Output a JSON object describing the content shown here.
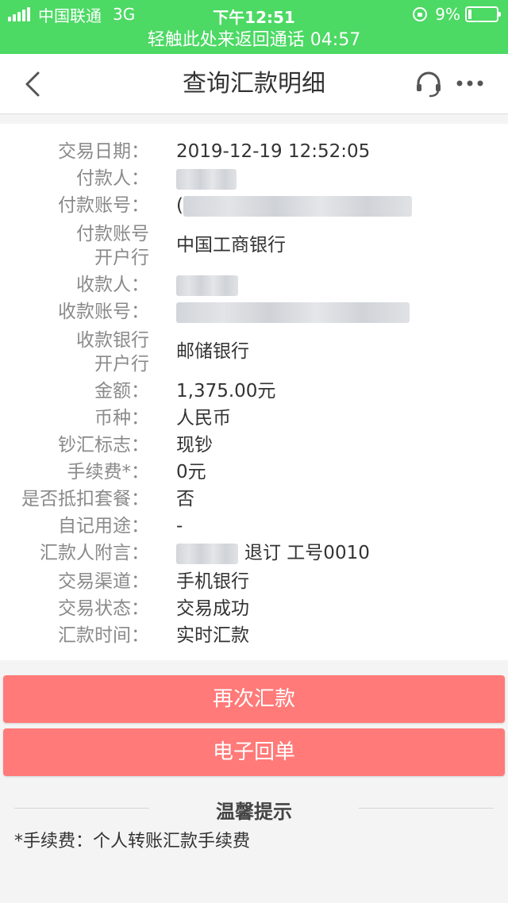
{
  "status_bar": {
    "carrier": "中国联通",
    "network": "3G",
    "time": "下午12:51",
    "battery": "9%"
  },
  "call_banner": {
    "text": "轻触此处来返回通话 04:57"
  },
  "header": {
    "title": "查询汇款明细"
  },
  "details": [
    {
      "label": "交易日期：",
      "value": "2019-12-19 12:52:05"
    },
    {
      "label": "付款人：",
      "value": ""
    },
    {
      "label": "付款账号：",
      "value": "("
    },
    {
      "label_lines": [
        "付款账号",
        "开户行"
      ],
      "value": "中国工商银行"
    },
    {
      "label": "收款人：",
      "value": ""
    },
    {
      "label": "收款账号：",
      "value": ""
    },
    {
      "label_lines": [
        "收款银行",
        "开户行"
      ],
      "value": "邮储银行"
    },
    {
      "label": "金额：",
      "value": "1,375.00元"
    },
    {
      "label": "币种：",
      "value": "人民币"
    },
    {
      "label": "钞汇标志：",
      "value": "现钞"
    },
    {
      "label": "手续费*：",
      "value": "0元"
    },
    {
      "label": "是否抵扣套餐：",
      "value": "否"
    },
    {
      "label": "自记用途：",
      "value": "-"
    },
    {
      "label": "汇款人附言：",
      "value": "退订 工号0010"
    },
    {
      "label": "交易渠道：",
      "value": "手机银行"
    },
    {
      "label": "交易状态：",
      "value": "交易成功"
    },
    {
      "label": "汇款时间：",
      "value": "实时汇款"
    }
  ],
  "buttons": {
    "remit_again": "再次汇款",
    "e_receipt": "电子回单"
  },
  "tips": {
    "title": "温馨提示",
    "text": "*手续费：个人转账汇款手续费"
  },
  "colors": {
    "banner_green": "#4cd964",
    "button_red": "#ff7a78"
  }
}
